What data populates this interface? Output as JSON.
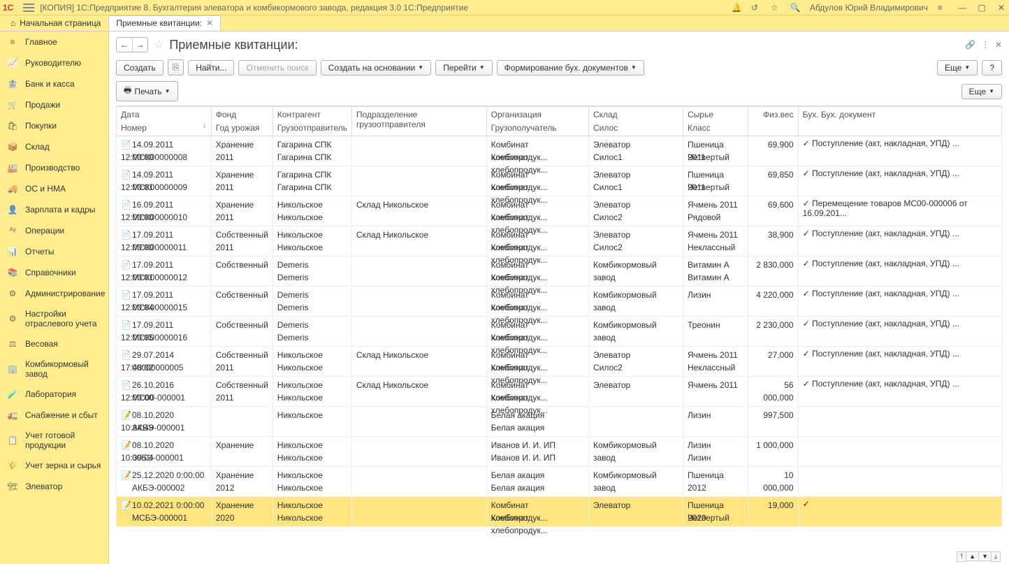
{
  "titlebar": {
    "logo": "1C",
    "title": "[КОПИЯ] 1С:Предприятие 8. Бухгалтерия элеватора и комбикормового завода, редакция 3.0 1С:Предприятие",
    "user": "Абдулов Юрий Владимирович"
  },
  "tabs": {
    "home": "Начальная страница",
    "active": "Приемные квитанции:"
  },
  "sidebar": {
    "items": [
      {
        "label": "Главное"
      },
      {
        "label": "Руководителю"
      },
      {
        "label": "Банк и касса"
      },
      {
        "label": "Продажи"
      },
      {
        "label": "Покупки"
      },
      {
        "label": "Склад"
      },
      {
        "label": "Производство"
      },
      {
        "label": "ОС и НМА"
      },
      {
        "label": "Зарплата и кадры"
      },
      {
        "label": "Операции"
      },
      {
        "label": "Отчеты"
      },
      {
        "label": "Справочники"
      },
      {
        "label": "Администрирование"
      },
      {
        "label": "Настройки отраслевого учета"
      },
      {
        "label": "Весовая"
      },
      {
        "label": "Комбикормовый завод"
      },
      {
        "label": "Лаборатория"
      },
      {
        "label": "Снабжение и сбыт"
      },
      {
        "label": "Учет готовой продукции"
      },
      {
        "label": "Учет зерна и сырья"
      },
      {
        "label": "Элеватор"
      }
    ]
  },
  "page": {
    "title": "Приемные квитанции:"
  },
  "toolbar": {
    "create": "Создать",
    "find": "Найти...",
    "cancel_find": "Отменить поиск",
    "create_based": "Создать на основании",
    "goto": "Перейти",
    "form_docs": "Формирование бух. документов",
    "more": "Еще",
    "help": "?",
    "print": "Печать"
  },
  "columns": {
    "c0": {
      "h1": "Дата",
      "h2": "Номер",
      "sort": "↓"
    },
    "c1": {
      "h1": "Фонд",
      "h2": "Год урожая"
    },
    "c2": {
      "h1": "Контрагент",
      "h2": "Грузоотправитель"
    },
    "c3": {
      "h1": "Подразделение грузоотправителя"
    },
    "c4": {
      "h1": "Организация",
      "h2": "Грузополучатель"
    },
    "c5": {
      "h1": "Склад",
      "h2": "Силос"
    },
    "c6": {
      "h1": "Сырье",
      "h2": "Класс"
    },
    "c7": {
      "h1": "Физ.вес"
    },
    "c8": {
      "h1": "Бух. Бух. документ"
    }
  },
  "rows": [
    {
      "date": "14.09.2011 12:00:00",
      "num": "МСК00000008",
      "fund": "Хранение",
      "year": "2011",
      "agent": "Гагарина СПК",
      "sender": "Гагарина СПК",
      "dept": "",
      "org": "Комбинат хлебопродук...",
      "consignee": "Комбинат хлебопродук...",
      "wh": "Элеватор",
      "silo": "Силос1",
      "raw": "Пшеница 2011",
      "cls": "Четвертый",
      "weight": "69,900",
      "bk": "✓",
      "doc": "Поступление (акт, накладная, УПД) ..."
    },
    {
      "date": "14.09.2011 12:00:01",
      "num": "МСК00000009",
      "fund": "Хранение",
      "year": "2011",
      "agent": "Гагарина СПК",
      "sender": "Гагарина СПК",
      "dept": "",
      "org": "Комбинат хлебопродук...",
      "consignee": "Комбинат хлебопродук...",
      "wh": "Элеватор",
      "silo": "Силос1",
      "raw": "Пшеница 2011",
      "cls": "Четвертый",
      "weight": "69,850",
      "bk": "✓",
      "doc": "Поступление (акт, накладная, УПД) ..."
    },
    {
      "date": "16.09.2011 12:00:00",
      "num": "МСК00000010",
      "fund": "Хранение",
      "year": "2011",
      "agent": "Никольское",
      "sender": "Никольское",
      "dept": "Склад Никольское",
      "org": "Комбинат хлебопродук...",
      "consignee": "Комбинат хлебопродук...",
      "wh": "Элеватор",
      "silo": "Силос2",
      "raw": "Ячмень 2011",
      "cls": "Рядовой",
      "weight": "69,600",
      "bk": "✓",
      "doc": "Перемещение товаров МС00-000006 от 16.09.201..."
    },
    {
      "date": "17.09.2011 12:00:00",
      "num": "МСК00000011",
      "fund": "Собственный",
      "year": "2011",
      "agent": "Никольское",
      "sender": "Никольское",
      "dept": "Склад Никольское",
      "org": "Комбинат хлебопродук...",
      "consignee": "Комбинат хлебопродук...",
      "wh": "Элеватор",
      "silo": "Силос2",
      "raw": "Ячмень 2011",
      "cls": "Неклассный",
      "weight": "38,900",
      "bk": "✓",
      "doc": "Поступление (акт, накладная, УПД) ..."
    },
    {
      "date": "17.09.2011 12:00:01",
      "num": "МСК00000012",
      "fund": "Собственный",
      "year": "",
      "agent": "Demeris",
      "sender": "Demeris",
      "dept": "",
      "org": "Комбинат хлебопродук...",
      "consignee": "Комбинат хлебопродук...",
      "wh": "Комбикормовый завод",
      "silo": "",
      "raw": "Витамин А",
      "cls": "Витамин А",
      "weight": "2 830,000",
      "bk": "✓",
      "doc": "Поступление (акт, накладная, УПД) ..."
    },
    {
      "date": "17.09.2011 12:00:04",
      "num": "МСК00000015",
      "fund": "Собственный",
      "year": "",
      "agent": "Demeris",
      "sender": "Demeris",
      "dept": "",
      "org": "Комбинат хлебопродук...",
      "consignee": "Комбинат хлебопродук...",
      "wh": "Комбикормовый завод",
      "silo": "",
      "raw": "Лизин",
      "cls": "",
      "weight": "4 220,000",
      "bk": "✓",
      "doc": "Поступление (акт, накладная, УПД) ..."
    },
    {
      "date": "17.09.2011 12:00:05",
      "num": "МСК00000016",
      "fund": "Собственный",
      "year": "",
      "agent": "Demeris",
      "sender": "Demeris",
      "dept": "",
      "org": "Комбинат хлебопродук...",
      "consignee": "Комбинат хлебопродук...",
      "wh": "Комбикормовый завод",
      "silo": "",
      "raw": "Треонин",
      "cls": "",
      "weight": "2 230,000",
      "bk": "✓",
      "doc": "Поступление (акт, накладная, УПД) ..."
    },
    {
      "date": "29.07.2014 17:48:02",
      "num": "00000000005",
      "fund": "Собственный",
      "year": "2011",
      "agent": "Никольское",
      "sender": "Никольское",
      "dept": "Склад Никольское",
      "org": "Комбинат хлебопродук...",
      "consignee": "Комбинат хлебопродук...",
      "wh": "Элеватор",
      "silo": "Силос2",
      "raw": "Ячмень 2011",
      "cls": "Неклассный",
      "weight": "27,000",
      "bk": "✓",
      "doc": "Поступление (акт, накладная, УПД) ..."
    },
    {
      "date": "26.10.2016 12:00:00",
      "num": "МС00-000001",
      "fund": "Собственный",
      "year": "2011",
      "agent": "Никольское",
      "sender": "Никольское",
      "dept": "Склад Никольское",
      "org": "Комбинат хлебопродук...",
      "consignee": "Комбинат хлебопродук...",
      "wh": "Элеватор",
      "silo": "",
      "raw": "Ячмень 2011",
      "cls": "",
      "weight": "56 000,000",
      "bk": "✓",
      "doc": "Поступление (акт, накладная, УПД) ..."
    },
    {
      "date": "08.10.2020 10:34:49",
      "num": "АКБЭ-000001",
      "fund": "",
      "year": "",
      "agent": "Никольское",
      "sender": "",
      "dept": "",
      "org": "Белая акация",
      "consignee": "Белая акация",
      "wh": "",
      "silo": "",
      "raw": "Лизин",
      "cls": "",
      "weight": "997,500",
      "bk": "",
      "doc": ""
    },
    {
      "date": "08.10.2020 10:39:04",
      "num": "00БЭ-000001",
      "fund": "Хранение",
      "year": "",
      "agent": "Никольское",
      "sender": "Никольское",
      "dept": "",
      "org": "Иванов И. И. ИП",
      "consignee": "Иванов И. И. ИП",
      "wh": "Комбикормовый завод",
      "silo": "",
      "raw": "Лизин",
      "cls": "Лизин",
      "weight": "1 000,000",
      "bk": "",
      "doc": ""
    },
    {
      "date": "25.12.2020 0:00:00",
      "num": "АКБЭ-000002",
      "fund": "Хранение",
      "year": "2012",
      "agent": "Никольское",
      "sender": "Никольское",
      "dept": "",
      "org": "Белая акация",
      "consignee": "Белая акация",
      "wh": "Комбикормовый завод",
      "silo": "",
      "raw": "Пшеница 2012",
      "cls": "",
      "weight": "10 000,000",
      "bk": "",
      "doc": ""
    },
    {
      "date": "10.02.2021 0:00:00",
      "num": "МСБЭ-000001",
      "fund": "Хранение",
      "year": "2020",
      "agent": "Никольское",
      "sender": "Никольское",
      "dept": "",
      "org": "Комбинат хлебопродук...",
      "consignee": "Комбинат хлебопродук...",
      "wh": "Элеватор",
      "silo": "",
      "raw": "Пшеница 2020",
      "cls": "Четвертый",
      "weight": "19,000",
      "bk": "✓",
      "doc": ""
    }
  ],
  "selected_row": 12
}
